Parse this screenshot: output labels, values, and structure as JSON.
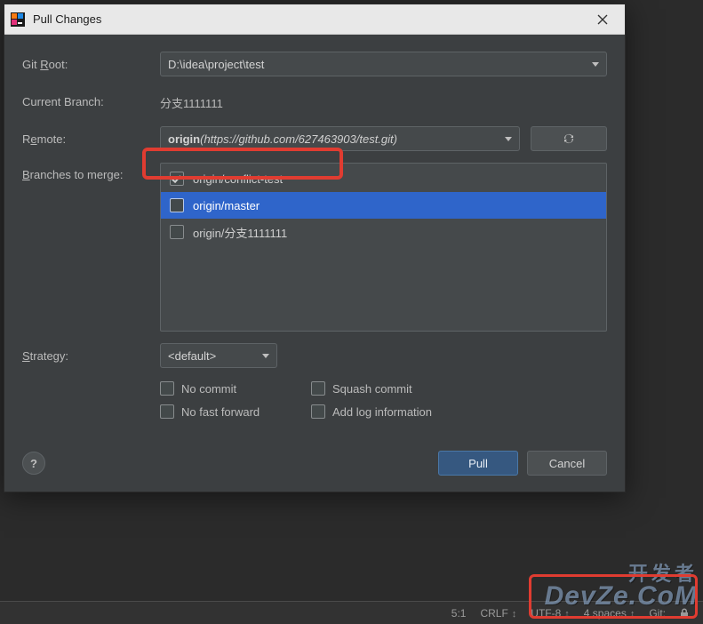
{
  "dialog": {
    "title": "Pull Changes",
    "labels": {
      "git_root": "Git Root:",
      "git_root_mn": "R",
      "current_branch": "Current Branch:",
      "remote": "Remote:",
      "remote_mn": "e",
      "branches": "Branches to merge:",
      "branches_mn": "B",
      "strategy": "Strategy:",
      "strategy_mn": "S"
    },
    "git_root_value": "D:\\idea\\project\\test",
    "current_branch_value": "分支1111111",
    "remote": {
      "name": "origin",
      "url": "https://github.com/627463903/test.git"
    },
    "branches": [
      {
        "label": "origin/conflict-test",
        "checked": true,
        "selected": false
      },
      {
        "label": "origin/master",
        "checked": false,
        "selected": true
      },
      {
        "label": "origin/分支1111111",
        "checked": false,
        "selected": false
      }
    ],
    "strategy_value": "<default>",
    "checks": {
      "no_commit": "No commit",
      "no_commit_mn": "c",
      "squash": "Squash commit",
      "squash_mn": "q",
      "no_ff": "No fast forward",
      "no_ff_mn": "f",
      "add_log": "Add log information",
      "add_log_mn": "l"
    },
    "buttons": {
      "help": "?",
      "pull": "Pull",
      "cancel": "Cancel"
    }
  },
  "statusbar": {
    "caret": "5:1",
    "eol": "CRLF",
    "encoding": "UTF-8",
    "indent": "4 spaces",
    "git": "Git:"
  },
  "watermark": {
    "cn": "开发者",
    "en": "DevZe.CoM"
  }
}
